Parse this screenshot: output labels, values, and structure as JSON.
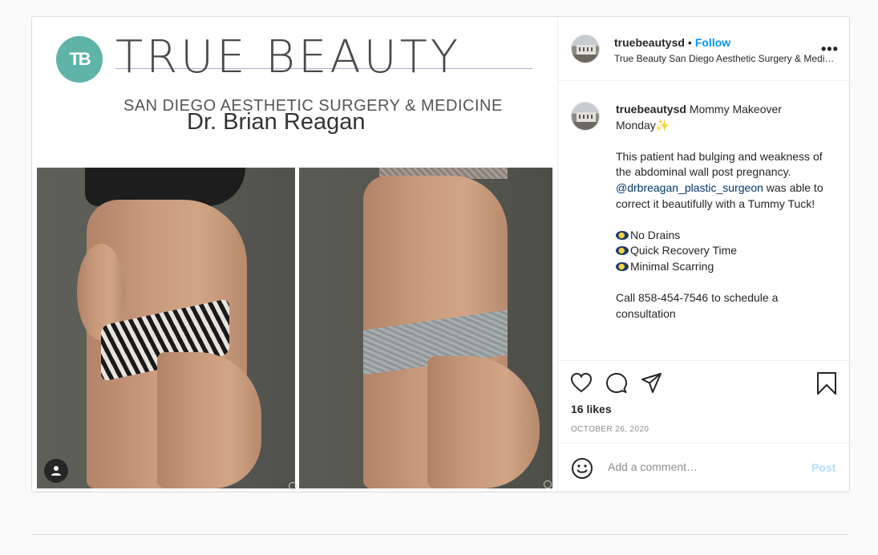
{
  "media": {
    "logo_mark": "TB",
    "logo_title": "TRUE BEAUTY",
    "logo_subtitle": "SAN DIEGO AESTHETIC SURGERY & MEDICINE",
    "doctor": "Dr. Brian Reagan"
  },
  "header": {
    "username": "truebeautysd",
    "follow_label": "Follow",
    "location": "True Beauty San Diego Aesthetic Surgery & Medicine",
    "more_label": "•••"
  },
  "caption": {
    "username": "truebeautysd",
    "title": "Mommy Makeover Monday",
    "sparkle": "✨",
    "para1_before": "This patient had bulging and weakness of the abdominal wall post pregnancy.",
    "mention": "@drbreagan_plastic_surgeon",
    "para1_after": "was able to correct it beautifully with a Tummy Tuck!",
    "bullets": [
      "No Drains",
      "Quick Recovery Time",
      "Minimal Scarring"
    ],
    "call": "Call 858-454-7546 to schedule a consultation"
  },
  "actions": {
    "likes": "16 likes",
    "date": "OCTOBER 26, 2020"
  },
  "comment": {
    "placeholder": "Add a comment…",
    "post_label": "Post"
  },
  "colors": {
    "accent": "#0095f6",
    "mention": "#00376b",
    "post_disabled": "#b2dffc",
    "logo_teal": "#5fb3a8"
  }
}
